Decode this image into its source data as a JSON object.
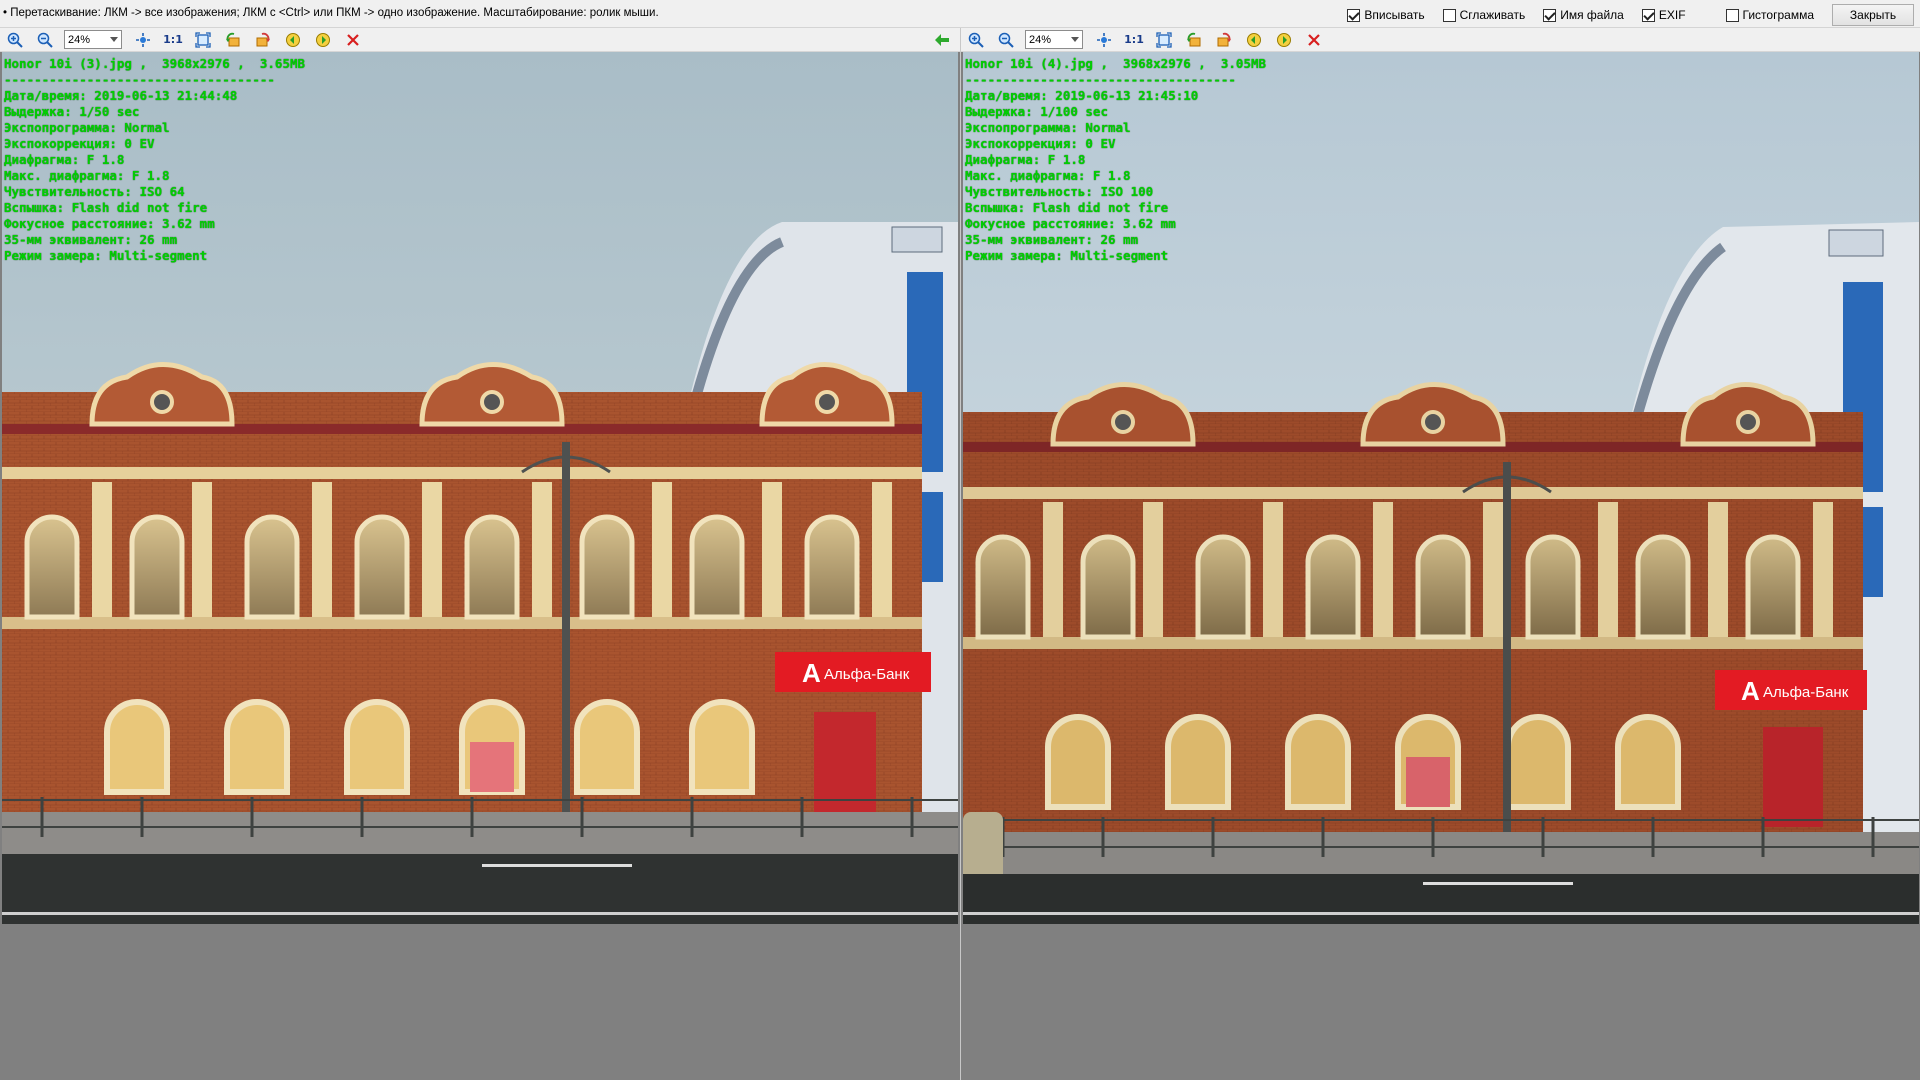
{
  "hint": "• Перетаскивание: ЛКМ -> все изображения; ЛКМ с <Ctrl> или ПКМ -> одно изображение. Масштабирование: ролик мыши.",
  "options": [
    {
      "label": "Вписывать",
      "checked": true
    },
    {
      "label": "Сглаживать",
      "checked": false
    },
    {
      "label": "Имя файла",
      "checked": true
    },
    {
      "label": "EXIF",
      "checked": true
    },
    {
      "label": "Гистограмма",
      "checked": false
    }
  ],
  "close_label": "Закрыть",
  "panes": [
    {
      "zoom": "24%",
      "toolbar_one_to_one": "1:1",
      "file_line": "Honor 10i (3).jpg ,  3968x2976 ,  3.65MB",
      "separator": "------------------------------------",
      "exif": [
        "Дата/время: 2019-06-13 21:44:48",
        "Выдержка: 1/50 sec",
        "Экспопрограмма: Normal",
        "Экспокоррекция: 0 EV",
        "Диафрагма: F 1.8",
        "Макс. диафрагма: F 1.8",
        "Чувствительность: ISO 64",
        "Вспышка: Flash did not fire",
        "Фокусное расстояние: 3.62 mm",
        "35-мм эквивалент: 26 mm",
        "Режим замера: Multi-segment"
      ],
      "sign_text": "Альфа-Банк",
      "sign_letter": "А"
    },
    {
      "zoom": "24%",
      "toolbar_one_to_one": "1:1",
      "file_line": "Honor 10i (4).jpg ,  3968x2976 ,  3.05MB",
      "separator": "------------------------------------",
      "exif": [
        "Дата/время: 2019-06-13 21:45:10",
        "Выдержка: 1/100 sec",
        "Экспопрограмма: Normal",
        "Экспокоррекция: 0 EV",
        "Диафрагма: F 1.8",
        "Макс. диафрагма: F 1.8",
        "Чувствительность: ISO 100",
        "Вспышка: Flash did not fire",
        "Фокусное расстояние: 3.62 mm",
        "35-мм эквивалент: 26 mm",
        "Режим замера: Multi-segment"
      ],
      "sign_text": "Альфа-Банк",
      "sign_letter": "А"
    }
  ],
  "icons": [
    "zoom-in-icon",
    "zoom-out-icon",
    "fit-icon",
    "fullscreen-icon",
    "rotate-left-icon",
    "rotate-right-icon",
    "prev-image-icon",
    "next-image-icon",
    "delete-icon",
    "back-arrow-icon"
  ],
  "colors": {
    "exif_text": "#00d000",
    "canvas": "#808080",
    "brick": "#a9542f",
    "sign_red": "#e31b23"
  }
}
